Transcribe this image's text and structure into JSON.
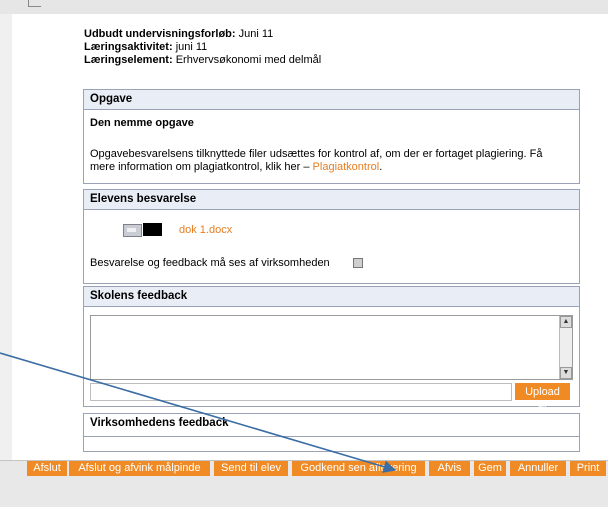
{
  "meta": {
    "forloeb_label": "Udbudt undervisningsforløb:",
    "forloeb_value": "Juni 11",
    "aktivitet_label": "Læringsaktivitet:",
    "aktivitet_value": "juni 11",
    "element_label": "Læringselement:",
    "element_value": "Erhvervsøkonomi med delmål"
  },
  "opgave": {
    "header": "Opgave",
    "title": "Den nemme opgave",
    "description": "Opgavebesvarelsens tilknyttede filer udsættes for kontrol af, om der er fortaget plagiering. Få mere information om plagiatkontrol, klik her – ",
    "link": "Plagiatkontrol",
    "link_suffix": "."
  },
  "elev": {
    "header": "Elevens besvarelse",
    "file": "dok 1.docx",
    "visibility_label": "Besvarelse og feedback må ses af virksomheden"
  },
  "skole": {
    "header": "Skolens feedback",
    "upload_label": "Upload fil"
  },
  "virksomhed": {
    "header": "Virksomhedens feedback"
  },
  "buttons": [
    "Afslut",
    "Afslut og afvink målpinde",
    "Send til elev",
    "Godkend sen aflevering",
    "Afvis",
    "Gem",
    "Annuller",
    "Print"
  ],
  "colors": {
    "accent": "#f08a24",
    "panel_header": "#e8edf6",
    "arrow": "#3a6ea5"
  }
}
